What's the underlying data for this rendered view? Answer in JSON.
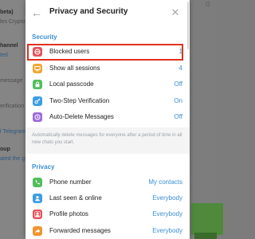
{
  "background": {
    "left_snippets": [
      "beta)",
      "les Crypto",
      "hannel",
      "ted",
      "message",
      "erification",
      "l Telegram",
      "oup",
      "ated the g"
    ],
    "right_snippets": [
      "Q"
    ]
  },
  "modal": {
    "title": "Privacy and Security",
    "back_icon": "arrow-left-icon",
    "close_icon": "close-icon",
    "security": {
      "heading": "Security",
      "items": [
        {
          "label": "Blocked users",
          "value": "1",
          "icon": "block-icon",
          "color": "#e5515b"
        },
        {
          "label": "Show all sessions",
          "value": "4",
          "icon": "sessions-icon",
          "color": "#f0a733"
        },
        {
          "label": "Local passcode",
          "value": "Off",
          "icon": "lock-icon",
          "color": "#52be5c"
        },
        {
          "label": "Two-Step Verification",
          "value": "On",
          "icon": "key-icon",
          "color": "#3d9ee5"
        },
        {
          "label": "Auto-Delete Messages",
          "value": "Off",
          "icon": "timer-icon",
          "color": "#9d6bdb"
        }
      ],
      "note": "Automatically delete messages for everyone after a period of time in all new chats you start."
    },
    "privacy": {
      "heading": "Privacy",
      "items": [
        {
          "label": "Phone number",
          "value": "My contacts",
          "icon": "phone-icon",
          "color": "#4fbf5b"
        },
        {
          "label": "Last seen & online",
          "value": "Everybody",
          "icon": "person-icon",
          "color": "#3d9ee5"
        },
        {
          "label": "Profile photos",
          "value": "Everybody",
          "icon": "profile-photo-icon",
          "color": "#e5515b"
        },
        {
          "label": "Forwarded messages",
          "value": "Everybody",
          "icon": "forward-icon",
          "color": "#f0952e"
        }
      ]
    }
  },
  "colors": {
    "accent": "#3a8fd6",
    "highlight": "#e0321f"
  }
}
